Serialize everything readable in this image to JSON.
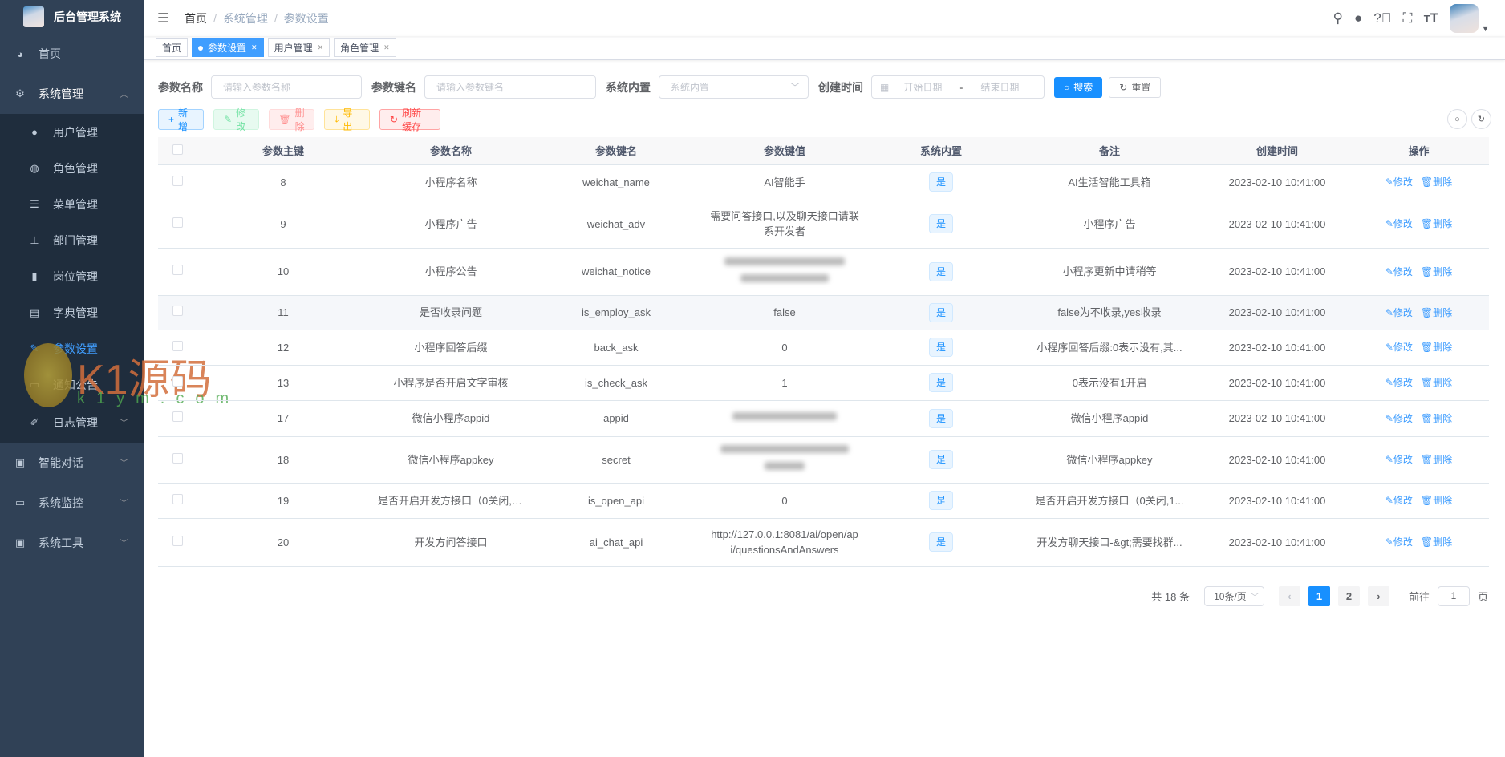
{
  "app": {
    "title": "后台管理系统"
  },
  "sidebar": {
    "items": [
      {
        "label": "首页",
        "icon": "dashboard-icon"
      },
      {
        "label": "系统管理",
        "icon": "gear-icon",
        "children": [
          {
            "label": "用户管理"
          },
          {
            "label": "角色管理"
          },
          {
            "label": "菜单管理"
          },
          {
            "label": "部门管理"
          },
          {
            "label": "岗位管理"
          },
          {
            "label": "字典管理"
          },
          {
            "label": "参数设置"
          },
          {
            "label": "通知公告"
          },
          {
            "label": "日志管理"
          }
        ]
      },
      {
        "label": "智能对话"
      },
      {
        "label": "系统监控"
      },
      {
        "label": "系统工具"
      }
    ]
  },
  "breadcrumb": [
    "首页",
    "系统管理",
    "参数设置"
  ],
  "tags": [
    "首页",
    "参数设置",
    "用户管理",
    "角色管理"
  ],
  "filters": {
    "name_label": "参数名称",
    "name_placeholder": "请输入参数名称",
    "key_label": "参数键名",
    "key_placeholder": "请输入参数键名",
    "type_label": "系统内置",
    "type_placeholder": "系统内置",
    "time_label": "创建时间",
    "start_placeholder": "开始日期",
    "end_placeholder": "结束日期",
    "date_sep": "-",
    "search": "搜索",
    "reset": "重置"
  },
  "toolbar": {
    "add": "新增",
    "edit": "修改",
    "delete": "删除",
    "export": "导出",
    "refresh": "刷新缓存"
  },
  "table": {
    "headers": [
      "参数主键",
      "参数名称",
      "参数键名",
      "参数键值",
      "系统内置",
      "备注",
      "创建时间",
      "操作"
    ],
    "op_edit": "修改",
    "op_delete": "删除",
    "rows": [
      {
        "id": "8",
        "name": "小程序名称",
        "key": "weichat_name",
        "value": "AI智能手",
        "builtin": "是",
        "remark": "AI生活智能工具箱",
        "time": "2023-02-10 10:41:00"
      },
      {
        "id": "9",
        "name": "小程序广告",
        "key": "weichat_adv",
        "value": "需要问答接口,以及聊天接口请联系开发者",
        "builtin": "是",
        "remark": "小程序广告",
        "time": "2023-02-10 10:41:00"
      },
      {
        "id": "10",
        "name": "小程序公告",
        "key": "weichat_notice",
        "value": null,
        "builtin": "是",
        "remark": "小程序更新中请稍等",
        "time": "2023-02-10 10:41:00"
      },
      {
        "id": "11",
        "name": "是否收录问题",
        "key": "is_employ_ask",
        "value": "false",
        "builtin": "是",
        "remark": "false为不收录,yes收录",
        "time": "2023-02-10 10:41:00"
      },
      {
        "id": "12",
        "name": "小程序回答后缀",
        "key": "back_ask",
        "value": "0",
        "builtin": "是",
        "remark": "小程序回答后缀:0表示没有,其...",
        "time": "2023-02-10 10:41:00"
      },
      {
        "id": "13",
        "name": "小程序是否开启文字审核",
        "key": "is_check_ask",
        "value": "1",
        "builtin": "是",
        "remark": "0表示没有1开启",
        "time": "2023-02-10 10:41:00"
      },
      {
        "id": "17",
        "name": "微信小程序appid",
        "key": "appid",
        "value": null,
        "builtin": "是",
        "remark": "微信小程序appid",
        "time": "2023-02-10 10:41:00"
      },
      {
        "id": "18",
        "name": "微信小程序appkey",
        "key": "secret",
        "value": null,
        "builtin": "是",
        "remark": "微信小程序appkey",
        "time": "2023-02-10 10:41:00"
      },
      {
        "id": "19",
        "name": "是否开启开发方接口（0关闭,1...",
        "key": "is_open_api",
        "value": "0",
        "builtin": "是",
        "remark": "是否开启开发方接口（0关闭,1...",
        "time": "2023-02-10 10:41:00"
      },
      {
        "id": "20",
        "name": "开发方问答接口",
        "key": "ai_chat_api",
        "value": "http://127.0.0.1:8081/ai/open/api/questionsAndAnswers",
        "builtin": "是",
        "remark": "开发方聊天接口-&gt;需要找群...",
        "time": "2023-02-10 10:41:00"
      }
    ]
  },
  "pagination": {
    "total": "共 18 条",
    "page_size": "10条/页",
    "pages": [
      "1",
      "2"
    ],
    "current": 1,
    "goto_label": "前往",
    "goto_value": "1",
    "page_suffix": "页"
  },
  "watermark": {
    "text": "K1源码",
    "sub": "k1ym.com"
  },
  "colors": {
    "primary": "#1890ff",
    "sidebar": "#304156",
    "submenu": "#1f2d3d"
  }
}
